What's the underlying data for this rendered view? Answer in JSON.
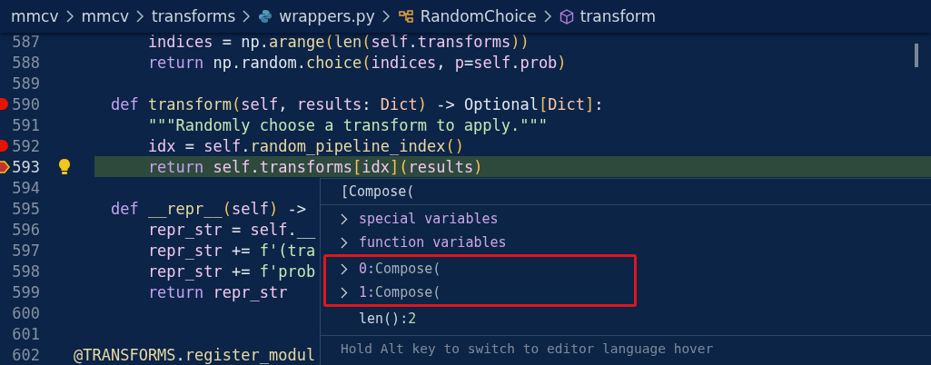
{
  "breadcrumbs": [
    {
      "label": "mmcv",
      "kind": "folder"
    },
    {
      "label": "mmcv",
      "kind": "folder"
    },
    {
      "label": "transforms",
      "kind": "folder"
    },
    {
      "label": "wrappers.py",
      "kind": "file"
    },
    {
      "label": "RandomChoice",
      "kind": "class"
    },
    {
      "label": "transform",
      "kind": "method"
    }
  ],
  "lines": [
    {
      "number": "587",
      "kind": "body",
      "breakpoint": false,
      "current": false,
      "lightbulb": false,
      "tokens": [
        {
          "kind": "v",
          "text": "indices"
        },
        {
          "kind": "p",
          "text": " = np."
        },
        {
          "kind": "f",
          "text": "arange"
        },
        {
          "kind": "b",
          "text": "("
        },
        {
          "kind": "f",
          "text": "len"
        },
        {
          "kind": "b",
          "text": "("
        },
        {
          "kind": "v",
          "text": "self"
        },
        {
          "kind": "p",
          "text": "."
        },
        {
          "kind": "v",
          "text": "transforms"
        },
        {
          "kind": "b",
          "text": "))"
        }
      ]
    },
    {
      "number": "588",
      "kind": "body",
      "breakpoint": false,
      "current": false,
      "lightbulb": false,
      "tokens": [
        {
          "kind": "k",
          "text": "return"
        },
        {
          "kind": "p",
          "text": " np.random."
        },
        {
          "kind": "f",
          "text": "choice"
        },
        {
          "kind": "b",
          "text": "("
        },
        {
          "kind": "v",
          "text": "indices"
        },
        {
          "kind": "p",
          "text": ", "
        },
        {
          "kind": "v",
          "text": "p"
        },
        {
          "kind": "p",
          "text": "="
        },
        {
          "kind": "v",
          "text": "self"
        },
        {
          "kind": "p",
          "text": "."
        },
        {
          "kind": "v",
          "text": "prob"
        },
        {
          "kind": "b",
          "text": ")"
        }
      ]
    },
    {
      "number": "589",
      "kind": "blank",
      "breakpoint": false,
      "current": false,
      "lightbulb": false
    },
    {
      "number": "590",
      "kind": "member",
      "breakpoint": true,
      "current": false,
      "lightbulb": false,
      "tokens": [
        {
          "kind": "k",
          "text": "def "
        },
        {
          "kind": "f",
          "text": "transform"
        },
        {
          "kind": "b",
          "text": "("
        },
        {
          "kind": "v",
          "text": "self"
        },
        {
          "kind": "p",
          "text": ", "
        },
        {
          "kind": "v",
          "text": "results"
        },
        {
          "kind": "p",
          "text": ": "
        },
        {
          "kind": "t",
          "text": "Dict"
        },
        {
          "kind": "b",
          "text": ")"
        },
        {
          "kind": "p",
          "text": " -> Optional"
        },
        {
          "kind": "b",
          "text": "["
        },
        {
          "kind": "t",
          "text": "Dict"
        },
        {
          "kind": "b",
          "text": "]"
        },
        {
          "kind": "p",
          "text": ":"
        }
      ]
    },
    {
      "number": "591",
      "kind": "body",
      "breakpoint": false,
      "current": false,
      "lightbulb": false,
      "tokens": [
        {
          "kind": "s",
          "text": "\"\"\"Randomly choose a transform to apply.\"\"\""
        }
      ]
    },
    {
      "number": "592",
      "kind": "body",
      "breakpoint": true,
      "current": false,
      "lightbulb": false,
      "tokens": [
        {
          "kind": "v",
          "text": "idx"
        },
        {
          "kind": "p",
          "text": " = "
        },
        {
          "kind": "v",
          "text": "self"
        },
        {
          "kind": "p",
          "text": "."
        },
        {
          "kind": "f",
          "text": "random_pipeline_index"
        },
        {
          "kind": "b",
          "text": "()"
        }
      ]
    },
    {
      "number": "593",
      "kind": "body",
      "breakpoint": true,
      "current": true,
      "lightbulb": true,
      "tokens": [
        {
          "kind": "k",
          "text": "return "
        },
        {
          "kind": "v",
          "text": "self"
        },
        {
          "kind": "p",
          "text": "."
        },
        {
          "kind": "v",
          "text": "transforms"
        },
        {
          "kind": "b",
          "text": "["
        },
        {
          "kind": "v",
          "text": "idx"
        },
        {
          "kind": "b",
          "text": "]("
        },
        {
          "kind": "v",
          "text": "results"
        },
        {
          "kind": "b",
          "text": ")"
        }
      ]
    },
    {
      "number": "594",
      "kind": "blank",
      "breakpoint": false,
      "current": false,
      "lightbulb": false
    },
    {
      "number": "595",
      "kind": "member",
      "breakpoint": false,
      "current": false,
      "lightbulb": false,
      "tokens": [
        {
          "kind": "k",
          "text": "def "
        },
        {
          "kind": "f",
          "text": "__repr__"
        },
        {
          "kind": "b",
          "text": "("
        },
        {
          "kind": "v",
          "text": "self"
        },
        {
          "kind": "b",
          "text": ")"
        },
        {
          "kind": "p",
          "text": " ->"
        }
      ]
    },
    {
      "number": "596",
      "kind": "body",
      "breakpoint": false,
      "current": false,
      "lightbulb": false,
      "tokens": [
        {
          "kind": "v",
          "text": "repr_str"
        },
        {
          "kind": "p",
          "text": " = "
        },
        {
          "kind": "v",
          "text": "self"
        },
        {
          "kind": "p",
          "text": ".__"
        }
      ]
    },
    {
      "number": "597",
      "kind": "body",
      "breakpoint": false,
      "current": false,
      "lightbulb": false,
      "tokens": [
        {
          "kind": "v",
          "text": "repr_str"
        },
        {
          "kind": "p",
          "text": " += "
        },
        {
          "kind": "s",
          "text": "f'(tra"
        }
      ]
    },
    {
      "number": "598",
      "kind": "body",
      "breakpoint": false,
      "current": false,
      "lightbulb": false,
      "tokens": [
        {
          "kind": "v",
          "text": "repr_str"
        },
        {
          "kind": "p",
          "text": " += "
        },
        {
          "kind": "s",
          "text": "f'prob"
        }
      ]
    },
    {
      "number": "599",
      "kind": "body",
      "breakpoint": false,
      "current": false,
      "lightbulb": false,
      "tokens": [
        {
          "kind": "k",
          "text": "return "
        },
        {
          "kind": "v",
          "text": "repr_str"
        }
      ]
    },
    {
      "number": "600",
      "kind": "blank",
      "breakpoint": false,
      "current": false,
      "lightbulb": false
    },
    {
      "number": "601",
      "kind": "blank",
      "breakpoint": false,
      "current": false,
      "lightbulb": false
    },
    {
      "number": "602",
      "kind": "top",
      "breakpoint": false,
      "current": false,
      "lightbulb": false,
      "tokens": [
        {
          "kind": "f",
          "text": "@TRANSFORMS"
        },
        {
          "kind": "p",
          "text": "."
        },
        {
          "kind": "f",
          "text": "register_modul"
        }
      ]
    }
  ],
  "hover": {
    "title": "[Compose(",
    "items": [
      {
        "name": "special variables",
        "expandable": true,
        "highlighted": false
      },
      {
        "name": "function variables",
        "expandable": true,
        "highlighted": false
      },
      {
        "name": "0:",
        "value": "Compose(",
        "expandable": true,
        "highlighted": true
      },
      {
        "name": "1:",
        "value": "Compose(",
        "expandable": true,
        "highlighted": true
      },
      {
        "name": "len():",
        "value": "2",
        "expandable": false,
        "highlighted": false
      }
    ],
    "footer": "Hold Alt key to switch to editor language hover"
  }
}
